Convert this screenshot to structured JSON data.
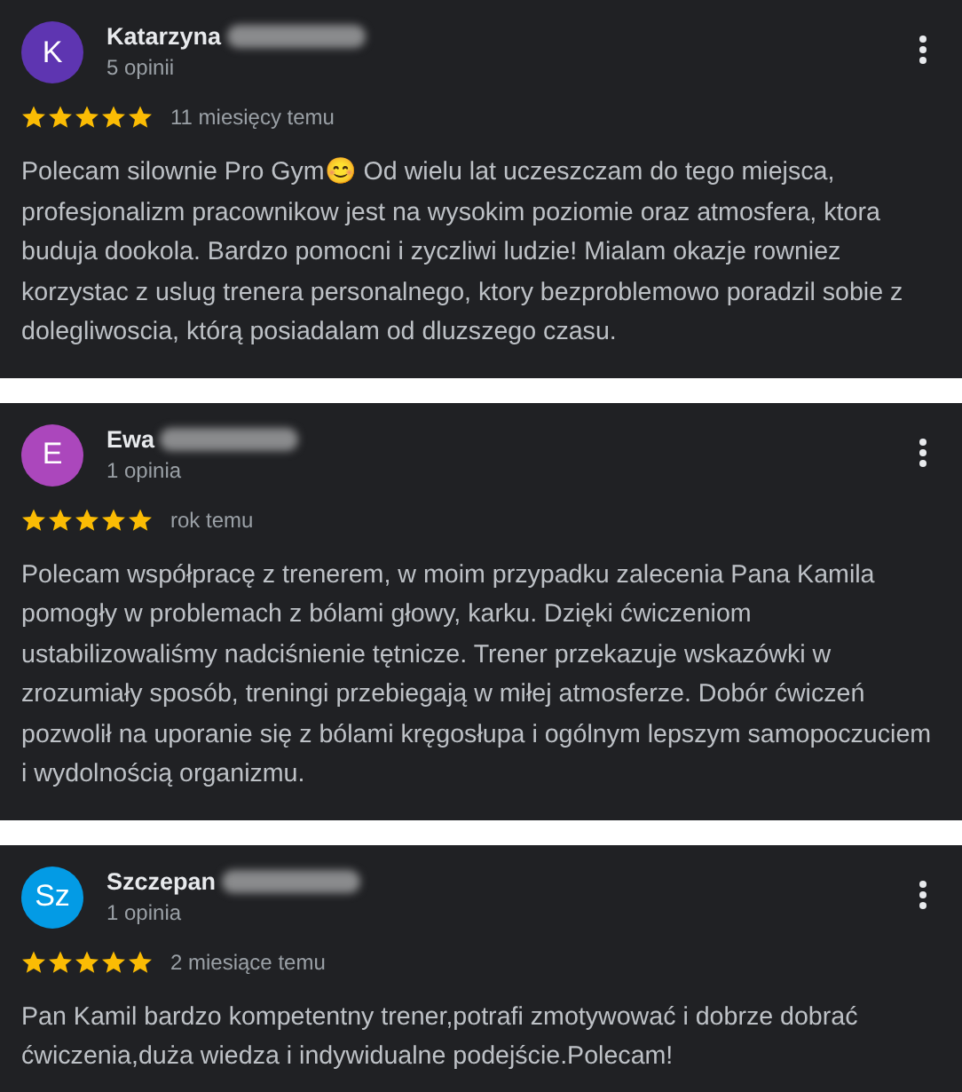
{
  "reviews": [
    {
      "initials": "K",
      "color": "#5e35b1",
      "name": "Katarzyna",
      "count": "5 opinii",
      "stars": 5,
      "time": "11 miesięcy temu",
      "text": "Polecam silownie Pro Gym😊  Od wielu lat uczeszczam do tego miejsca, profesjonalizm pracownikow jest na wysokim poziomie oraz atmosfera, ktora buduja dookola. Bardzo pomocni i zyczliwi ludzie! Mialam okazje rowniez korzystac z uslug trenera personalnego, ktory bezproblemowo poradzil sobie z dolegliwoscia, którą posiadalam od dluzszego czasu."
    },
    {
      "initials": "E",
      "color": "#ab47bc",
      "name": "Ewa",
      "count": "1 opinia",
      "stars": 5,
      "time": "rok temu",
      "text": "Polecam współpracę z trenerem, w moim przypadku zalecenia Pana Kamila pomogły w problemach z bólami głowy, karku. Dzięki ćwiczeniom ustabilizowaliśmy nadciśnienie tętnicze. Trener przekazuje wskazówki w zrozumiały sposób, treningi przebiegają w miłej atmosferze. Dobór ćwiczeń pozwolił na uporanie się z bólami kręgosłupa i ogólnym lepszym samopoczuciem i wydolnością organizmu."
    },
    {
      "initials": "Sz",
      "color": "#039be5",
      "name": "Szczepan",
      "count": "1 opinia",
      "stars": 5,
      "time": "2 miesiące temu",
      "text": "Pan Kamil bardzo kompetentny trener,potrafi zmotywować i dobrze dobrać ćwiczenia,duża wiedza i indywidualne podejście.Polecam!"
    }
  ]
}
